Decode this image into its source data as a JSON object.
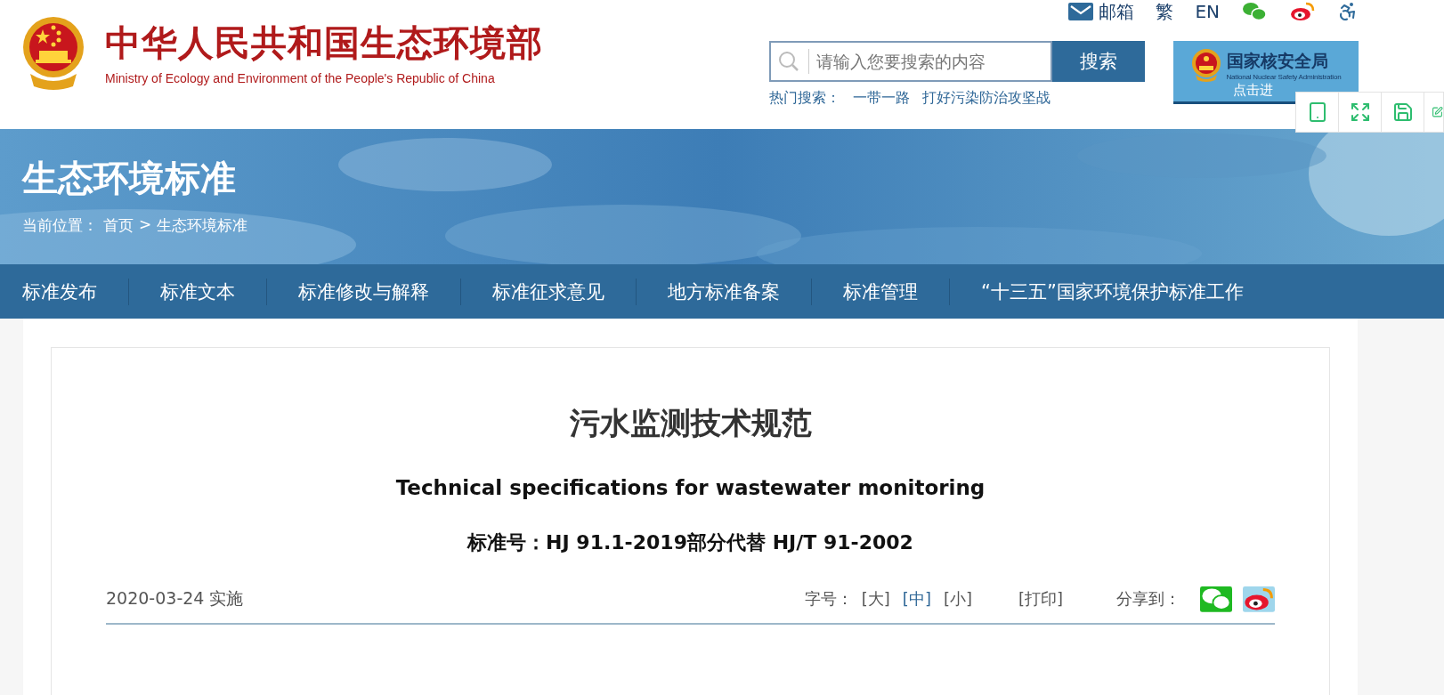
{
  "header": {
    "title": "中华人民共和国生态环境部",
    "subtitle": "Ministry of Ecology and Environment of the People's Republic of China"
  },
  "top_links": [
    {
      "kind": "mail",
      "label": "邮箱"
    },
    {
      "kind": "text",
      "label": "繁"
    },
    {
      "kind": "text",
      "label": "EN"
    },
    {
      "kind": "wechat"
    },
    {
      "kind": "weibo"
    },
    {
      "kind": "accessibility"
    }
  ],
  "search": {
    "placeholder": "请输入您要搜索的内容",
    "button": "搜索"
  },
  "hot_search": {
    "label": "热门搜索：",
    "terms": [
      "一带一路",
      "打好污染防治攻坚战"
    ]
  },
  "nuclear_banner": {
    "title": "国家核安全局",
    "subtitle": "National Nuclear Safety Administration",
    "link": "点击进"
  },
  "float_toolbar": [
    {
      "kind": "tablet"
    },
    {
      "kind": "expand"
    },
    {
      "kind": "save"
    },
    {
      "kind": "edit"
    }
  ],
  "banner": {
    "title": "生态环境标准",
    "breadcrumb": [
      "当前位置：",
      "首页",
      ">",
      "生态环境标准"
    ]
  },
  "nav": [
    "标准发布",
    "标准文本",
    "标准修改与解释",
    "标准征求意见",
    "地方标准备案",
    "标准管理",
    "“十三五”国家环境保护标准工作"
  ],
  "article": {
    "title": "污水监测技术规范",
    "english_title": "Technical specifications for wastewater monitoring",
    "standard_number": "标准号：HJ 91.1-2019部分代替 HJ/T 91-2002",
    "effective_date": "2020-03-24 实施",
    "font_size": {
      "label": "字号：",
      "options": [
        {
          "label": "[大]",
          "selected": false
        },
        {
          "label": "[中]",
          "selected": true
        },
        {
          "label": "[小]",
          "selected": false
        }
      ]
    },
    "print": "[打印]",
    "share": {
      "label": "分享到：",
      "targets": [
        {
          "kind": "wechat"
        },
        {
          "kind": "weibo"
        }
      ]
    }
  }
}
